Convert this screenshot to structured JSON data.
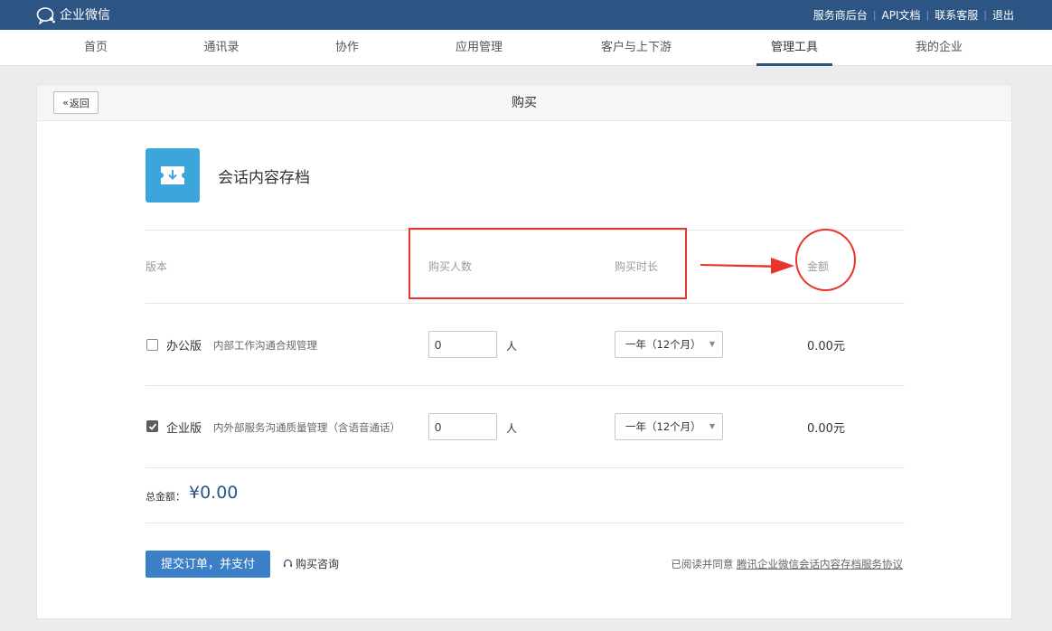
{
  "topbar": {
    "logo_text": "企业微信",
    "links": [
      "服务商后台",
      "API文档",
      "联系客服",
      "退出"
    ]
  },
  "nav": {
    "items": [
      "首页",
      "通讯录",
      "协作",
      "应用管理",
      "客户与上下游",
      "管理工具",
      "我的企业"
    ],
    "active": "管理工具"
  },
  "card": {
    "back_label": "返回",
    "title": "购买"
  },
  "product": {
    "name": "会话内容存档",
    "icon": "download-card-icon"
  },
  "columns": {
    "edition": "版本",
    "people": "购买人数",
    "duration": "购买时长",
    "amount": "金额"
  },
  "rows": [
    {
      "checked": false,
      "name": "办公版",
      "desc": "内部工作沟通合规管理",
      "count": "0",
      "unit": "人",
      "duration": "一年（12个月）",
      "amount": "0.00元"
    },
    {
      "checked": true,
      "name": "企业版",
      "desc": "内外部服务沟通质量管理（含语音通话）",
      "count": "0",
      "unit": "人",
      "duration": "一年（12个月）",
      "amount": "0.00元"
    }
  ],
  "total": {
    "label": "总金额：",
    "value": "¥0.00"
  },
  "footer": {
    "submit_label": "提交订单，并支付",
    "consult_label": "购买咨询",
    "agree_prefix": "已阅读并同意",
    "agree_link": "腾讯企业微信会话内容存档服务协议"
  },
  "colors": {
    "topbar": "#2d5584",
    "accent": "#3b7fc6",
    "product_icon": "#3ba5dc",
    "annotation": "#e8342a"
  }
}
